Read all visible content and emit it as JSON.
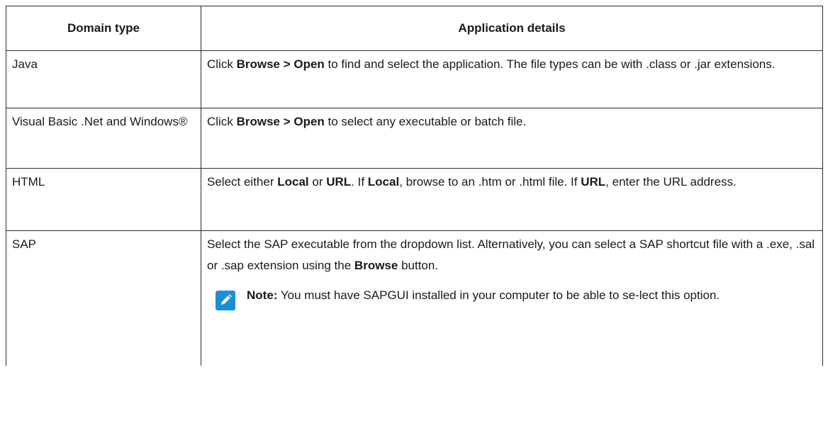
{
  "table": {
    "headers": {
      "domain_type": "Domain type",
      "application_details": "Application details"
    },
    "rows": {
      "java": {
        "domain": "Java",
        "details": {
          "pre": "Click ",
          "bold1": "Browse > Open",
          "post": " to find and select the application. The file types can be with .class or .jar extensions."
        }
      },
      "vb": {
        "domain": "Visual Basic .Net and Windows®",
        "details": {
          "pre": "Click ",
          "bold1": "Browse > Open",
          "post": " to select any executable or batch file."
        }
      },
      "html": {
        "domain": "HTML",
        "details": {
          "t1": "Select either ",
          "b1": "Local",
          "t2": " or ",
          "b2": "URL",
          "t3": ". If ",
          "b3": "Local",
          "t4": ", browse to an .htm or .html file. If ",
          "b4": "URL",
          "t5": ", enter the URL address."
        }
      },
      "sap": {
        "domain": "SAP",
        "details": {
          "t1": "Select the SAP executable from the dropdown list. Alternatively, you can select a SAP shortcut file with a .exe, .sal or .sap extension using the ",
          "b1": "Browse",
          "t2": " button."
        },
        "note": {
          "icon": "pencil-note-icon",
          "label": "Note:",
          "text": " You must have SAPGUI installed in your computer to be able to se-lect this option."
        }
      }
    }
  },
  "colors": {
    "note_icon_bg": "#1a8fd6",
    "border": "#2b2b2b"
  }
}
